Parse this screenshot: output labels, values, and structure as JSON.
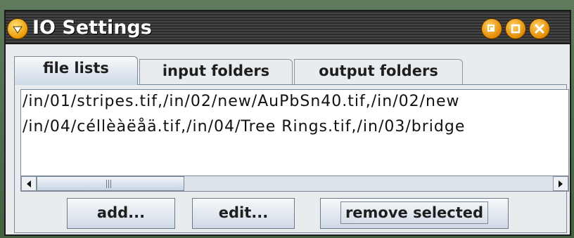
{
  "window": {
    "title": "IO Settings",
    "icons": {
      "menu": "menu-icon",
      "iconify": "iconify-icon",
      "maximize": "maximize-icon",
      "close": "close-icon"
    }
  },
  "tabs": [
    {
      "label": "file lists",
      "active": true
    },
    {
      "label": "input folders",
      "active": false
    },
    {
      "label": "output folders",
      "active": false
    }
  ],
  "file_list": {
    "lines": [
      "/in/01/stripes.tif,/in/02/new/AuPbSn40.tif,/in/02/new",
      "/in/04/céllèàëåä.tif,/in/04/Tree Rings.tif,/in/03/bridge"
    ]
  },
  "scrollbar": {
    "position": 0.0,
    "icons": {
      "left": "arrow-left-icon",
      "right": "arrow-right-icon"
    }
  },
  "buttons": {
    "add": "add...",
    "edit": "edit...",
    "remove": "remove selected"
  },
  "colors": {
    "title_bar": "#2b2b2b",
    "window_bg": "#e9ecef",
    "title_buttons": "#e89a00"
  }
}
